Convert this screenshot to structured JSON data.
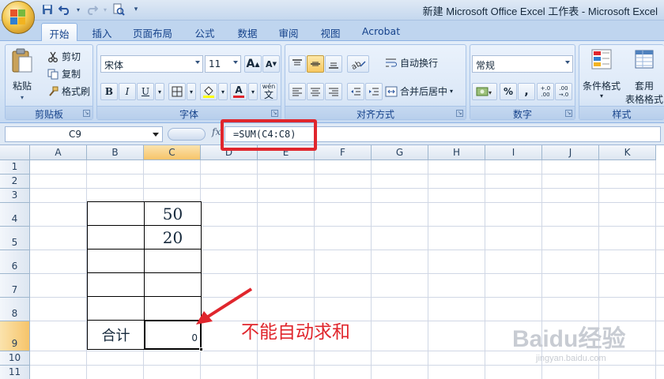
{
  "window": {
    "title": "新建 Microsoft Office Excel 工作表 - Microsoft Excel"
  },
  "quick_access": [
    "save-icon",
    "undo-icon",
    "redo-icon",
    "print-preview-icon",
    "customize-qat-icon"
  ],
  "tabs": [
    "开始",
    "插入",
    "页面布局",
    "公式",
    "数据",
    "审阅",
    "视图",
    "Acrobat"
  ],
  "active_tab": "开始",
  "ribbon": {
    "clipboard": {
      "label": "剪贴板",
      "paste": "粘贴",
      "cut": "剪切",
      "copy": "复制",
      "format_painter": "格式刷"
    },
    "font": {
      "label": "字体",
      "font_name": "宋体",
      "font_size": "11",
      "bold": "B",
      "italic": "I",
      "underline": "U",
      "phonetic": "wén",
      "font_color_letter": "A"
    },
    "alignment": {
      "label": "对齐方式",
      "wrap_text": "自动换行",
      "merge_center": "合并后居中"
    },
    "number": {
      "label": "数字",
      "format": "常规",
      "percent": "%",
      "comma": ",",
      "inc_decimal": "+.0\n.00",
      "dec_decimal": ".00\n→.0"
    },
    "styles": {
      "label": "样式",
      "conditional": "条件格式",
      "table_format_1": "套用",
      "table_format_2": "表格格式"
    }
  },
  "formula_bar": {
    "name_box": "C9",
    "fx": "fx",
    "formula": "=SUM(C4:C8)"
  },
  "columns": [
    "A",
    "B",
    "C",
    "D",
    "E",
    "F",
    "G",
    "H",
    "I",
    "J",
    "K"
  ],
  "rows": [
    "1",
    "2",
    "3",
    "4",
    "5",
    "6",
    "7",
    "8",
    "9",
    "10",
    "11"
  ],
  "selected_cell": {
    "column": "C",
    "row": "9"
  },
  "cells": {
    "C4": "50",
    "C5": "20",
    "B9": "合计",
    "C9": "0"
  },
  "annotation": "不能自动求和",
  "watermark": {
    "main": "Baidu经验",
    "sub": "jingyan.baidu.com"
  },
  "colors": {
    "highlight_red": "#e0262d",
    "selected_header": "#f6c46a",
    "ribbon_blue": "#c5d9f1"
  }
}
